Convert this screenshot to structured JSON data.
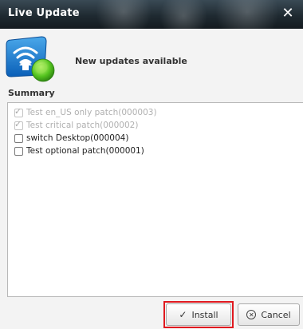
{
  "window": {
    "title": "Live Update",
    "close_glyph": "✕"
  },
  "header": {
    "icon": "wifi-update-globe-icon",
    "headline": "New updates available"
  },
  "summary": {
    "label": "Summary",
    "items": [
      {
        "label": "Test en_US only patch(000003)",
        "checked": true,
        "disabled": true
      },
      {
        "label": "Test critical patch(000002)",
        "checked": true,
        "disabled": true
      },
      {
        "label": "switch Desktop(000004)",
        "checked": false,
        "disabled": false
      },
      {
        "label": "Test optional patch(000001)",
        "checked": false,
        "disabled": false
      }
    ]
  },
  "buttons": {
    "install": "Install",
    "cancel": "Cancel"
  },
  "colors": {
    "title_bar": "#1f2a31",
    "highlight": "#e0191f"
  }
}
